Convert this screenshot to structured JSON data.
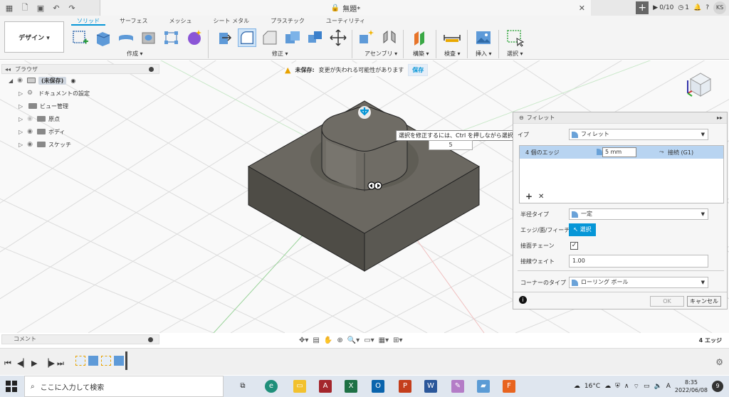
{
  "titlebar": {
    "doc_title": "無題*",
    "job_count": "0/10",
    "notify_count": "1",
    "user_initials": "KS"
  },
  "ribbon": {
    "design_label": "デザイン ▾",
    "tabs": [
      "ソリッド",
      "サーフェス",
      "メッシュ",
      "シート メタル",
      "プラスチック",
      "ユーティリティ"
    ],
    "groups": {
      "create": "作成 ▾",
      "modify": "修正 ▾",
      "assemble": "アセンブリ ▾",
      "construct": "構築 ▾",
      "inspect": "検査 ▾",
      "insert": "挿入 ▾",
      "select": "選択 ▾"
    }
  },
  "browser": {
    "title": "ブラウザ",
    "items": [
      {
        "label": "(未保存)"
      },
      {
        "label": "ドキュメントの設定"
      },
      {
        "label": "ビュー管理"
      },
      {
        "label": "原点"
      },
      {
        "label": "ボディ"
      },
      {
        "label": "スケッチ"
      }
    ]
  },
  "warning": {
    "label": "未保存:",
    "message": "変更が失われる可能性があります",
    "save": "保存"
  },
  "tooltip": "選択を修正するには、Ctrl を押しながら選択します",
  "numbox_value": "5",
  "fillet": {
    "title": "フィレット",
    "type_label": "イプ",
    "type_value": "フィレット",
    "edge_row_label": "4 個のエッジ",
    "edge_radius": "5 mm",
    "edge_continuity": "接続 (G1)",
    "radius_type_label": "半径タイプ",
    "radius_type_value": "一定",
    "entity_label": "エッジ/面/フィーチャ",
    "select_btn": "選択",
    "tangent_chain_label": "接面チェーン",
    "tangent_weight_label": "接線ウェイト",
    "tangent_weight_value": "1.00",
    "corner_type_label": "コーナーのタイプ",
    "corner_type_value": "ローリング ボール",
    "ok": "OK",
    "cancel": "キャンセル"
  },
  "comment_label": "コメント",
  "edge_count": "4 エッジ",
  "taskbar": {
    "search_placeholder": "ここに入力して検索",
    "temperature": "16°C",
    "ime": "A",
    "time": "8:35",
    "date": "2022/06/08",
    "notify": "9"
  },
  "colors": {
    "accent": "#0696d7",
    "warn": "#e8a200",
    "model": "#4e4c46"
  }
}
